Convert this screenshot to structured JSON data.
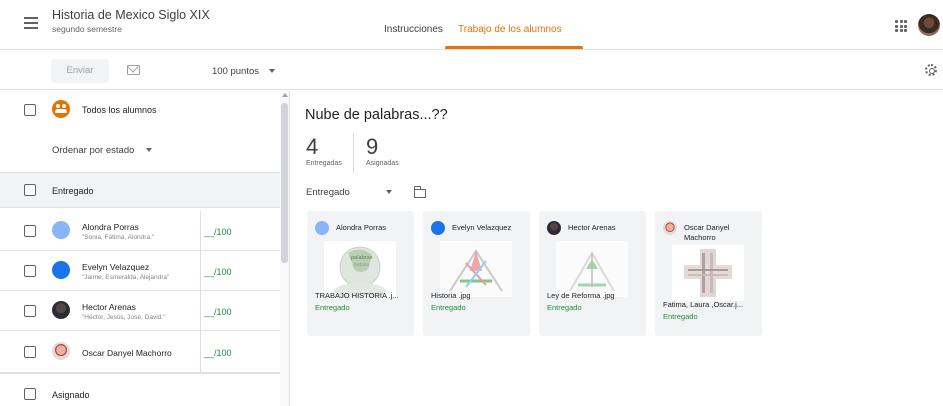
{
  "header": {
    "course_title": "Historia de Mexico Siglo XIX",
    "course_subtitle": "segundo semestre",
    "tabs": [
      {
        "label": "Instrucciones",
        "active": false
      },
      {
        "label": "Trabajo de los alumnos",
        "active": true
      }
    ],
    "accent_color": "#e8710a"
  },
  "toolbar": {
    "send_label": "Enviar",
    "points_label": "100 puntos"
  },
  "left_panel": {
    "all_students_label": "Todos los alumnos",
    "sort_label": "Ordenar por estado",
    "sections": [
      {
        "label": "Entregado"
      },
      {
        "label": "Asignado"
      }
    ],
    "students": [
      {
        "name": "Alondra Porras",
        "subtitle": "\"Sonia, Fátima, Alondra.\"",
        "grade": "__/100"
      },
      {
        "name": "Evelyn Velazquez",
        "subtitle": "\"Jaime, Esmeralda, Alejandra\"",
        "grade": "__/100"
      },
      {
        "name": "Hector Arenas",
        "subtitle": "\"Héctor, Jesús, José, David.\"",
        "grade": "__/100"
      },
      {
        "name": "Oscar Danyel Machorro",
        "subtitle": "",
        "grade": "__/100"
      }
    ]
  },
  "assignment": {
    "title": "Nube de palabras...??",
    "turned_in_count": "4",
    "turned_in_label": "Entregadas",
    "assigned_count": "9",
    "assigned_label": "Asignadas",
    "filter_label": "Entregado"
  },
  "cards": [
    {
      "name": "Alondra Porras",
      "file": "TRABAJO HISTORIA .j...",
      "status": "Entregado",
      "avatar": "person-icon"
    },
    {
      "name": "Evelyn Velazquez",
      "file": "Historia .jpg",
      "status": "Entregado",
      "avatar": "person-icon"
    },
    {
      "name": "Hector Arenas",
      "file": "Ley de Reforma .jpg",
      "status": "Entregado",
      "avatar": "photo"
    },
    {
      "name": "Oscar Danyel Machorro",
      "file": "Fatima, Laura ,Oscar.j...",
      "status": "Entregado",
      "avatar": "photo"
    }
  ]
}
